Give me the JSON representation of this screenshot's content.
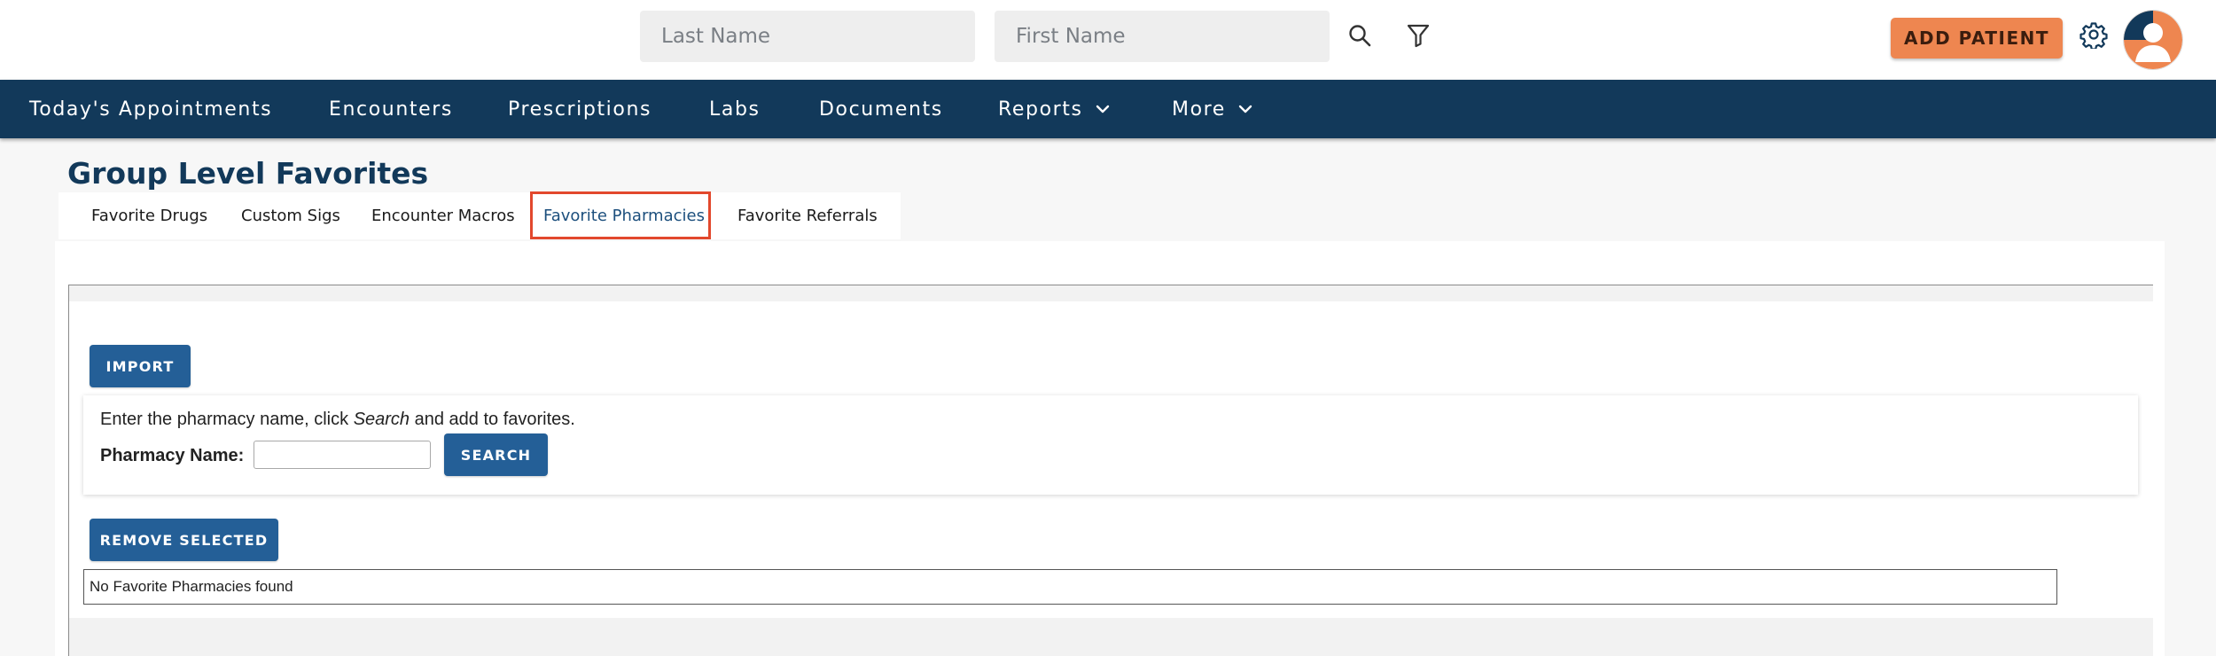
{
  "header": {
    "last_name_placeholder": "Last Name",
    "first_name_placeholder": "First Name",
    "add_patient_label": "ADD PATIENT",
    "search_icon": "search-icon",
    "filter_icon": "filter-icon",
    "settings_icon": "gear-icon",
    "avatar_icon": "user-avatar-icon"
  },
  "nav": {
    "items": [
      {
        "label": "Today's Appointments",
        "has_dropdown": false
      },
      {
        "label": "Encounters",
        "has_dropdown": false
      },
      {
        "label": "Prescriptions",
        "has_dropdown": false
      },
      {
        "label": "Labs",
        "has_dropdown": false
      },
      {
        "label": "Documents",
        "has_dropdown": false
      },
      {
        "label": "Reports",
        "has_dropdown": true
      },
      {
        "label": "More",
        "has_dropdown": true
      }
    ]
  },
  "page": {
    "title": "Group Level Favorites"
  },
  "tabs": {
    "items": [
      {
        "label": "Favorite Drugs",
        "active": false
      },
      {
        "label": "Custom Sigs",
        "active": false
      },
      {
        "label": "Encounter Macros",
        "active": false
      },
      {
        "label": "Favorite Pharmacies",
        "active": true
      },
      {
        "label": "Favorite Referrals",
        "active": false
      }
    ]
  },
  "content": {
    "import_label": "IMPORT",
    "instruction_prefix": "Enter the pharmacy name, click ",
    "instruction_emphasis": "Search",
    "instruction_suffix": " and add to favorites.",
    "pharmacy_name_label": "Pharmacy Name:",
    "pharmacy_name_value": "",
    "search_label": "SEARCH",
    "remove_selected_label": "REMOVE SELECTED",
    "empty_message": "No Favorite Pharmacies found"
  },
  "colors": {
    "nav_background": "#12395a",
    "accent_orange": "#ee8650",
    "button_blue": "#245f97",
    "highlight_red": "#e2482d"
  }
}
